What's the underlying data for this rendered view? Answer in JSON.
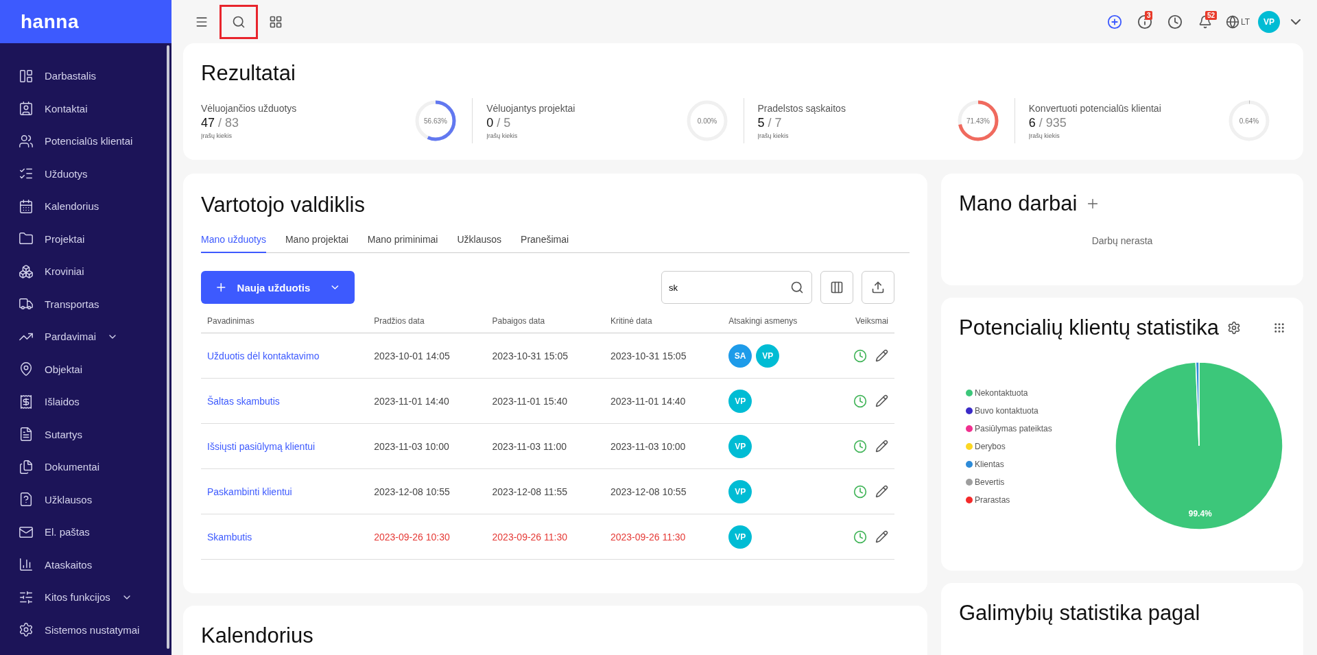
{
  "sidebar": {
    "logo": "hanna",
    "items": [
      {
        "label": "Darbastalis",
        "expandable": false
      },
      {
        "label": "Kontaktai",
        "expandable": false
      },
      {
        "label": "Potencialūs klientai",
        "expandable": false
      },
      {
        "label": "Užduotys",
        "expandable": false
      },
      {
        "label": "Kalendorius",
        "expandable": false
      },
      {
        "label": "Projektai",
        "expandable": false
      },
      {
        "label": "Kroviniai",
        "expandable": false
      },
      {
        "label": "Transportas",
        "expandable": false
      },
      {
        "label": "Pardavimai",
        "expandable": true
      },
      {
        "label": "Objektai",
        "expandable": false
      },
      {
        "label": "Išlaidos",
        "expandable": false
      },
      {
        "label": "Sutartys",
        "expandable": false
      },
      {
        "label": "Dokumentai",
        "expandable": false
      },
      {
        "label": "Užklausos",
        "expandable": false
      },
      {
        "label": "El. paštas",
        "expandable": false
      },
      {
        "label": "Ataskaitos",
        "expandable": false
      },
      {
        "label": "Kitos funkcijos",
        "expandable": true
      },
      {
        "label": "Sistemos nustatymai",
        "expandable": false
      }
    ]
  },
  "topbar": {
    "search_highlighted": true,
    "info_badge": "3",
    "notifications_badge": "52",
    "language": "LT",
    "user_initials": "VP"
  },
  "results": {
    "title": "Rezultatai",
    "metrics": [
      {
        "label": "Vėluojančios užduotys",
        "value": "47",
        "total": "/ 83",
        "caption": "Įrašų kiekis",
        "percent": "56.63%",
        "level": 0.5663,
        "color": "#6278f0"
      },
      {
        "label": "Vėluojantys projektai",
        "value": "0",
        "total": "/ 5",
        "caption": "Įrašų kiekis",
        "percent": "0.00%",
        "level": 0
      },
      {
        "label": "Pradelstos sąskaitos",
        "value": "5",
        "total": "/ 7",
        "caption": "Įrašų kiekis",
        "percent": "71.43%",
        "level": 0.7143,
        "color": "#f06a5e"
      },
      {
        "label": "Konvertuoti potencialūs klientai",
        "value": "6",
        "total": "/ 935",
        "caption": "Įrašų kiekis",
        "percent": "0.64%",
        "level": 0.0064
      }
    ]
  },
  "user_widget": {
    "title": "Vartotojo valdiklis",
    "tabs": [
      {
        "label": "Mano užduotys",
        "selected": true
      },
      {
        "label": "Mano projektai",
        "selected": false
      },
      {
        "label": "Mano priminimai",
        "selected": false
      },
      {
        "label": "Užklausos",
        "selected": false
      },
      {
        "label": "Pranešimai",
        "selected": false
      }
    ],
    "new_button": "Nauja užduotis",
    "search": {
      "value": "sk"
    },
    "columns": [
      "Pavadinimas",
      "Pradžios data",
      "Pabaigos data",
      "Kritinė data",
      "Atsakingi asmenys",
      "Veiksmai"
    ],
    "rows": [
      {
        "name": "Užduotis dėl kontaktavimo",
        "start": "2023-10-01 14:05",
        "end": "2023-10-31 15:05",
        "critical": "2023-10-31 15:05",
        "overdue": false,
        "assignees": [
          {
            "initials": "SA",
            "color": "#1e9be9"
          },
          {
            "initials": "VP",
            "color": "#00bcd4"
          }
        ]
      },
      {
        "name": "Šaltas skambutis",
        "start": "2023-11-01 14:40",
        "end": "2023-11-01 15:40",
        "critical": "2023-11-01 14:40",
        "overdue": false,
        "assignees": [
          {
            "initials": "VP",
            "color": "#00bcd4"
          }
        ]
      },
      {
        "name": "Išsiųsti pasiūlymą klientui",
        "start": "2023-11-03 10:00",
        "end": "2023-11-03 11:00",
        "critical": "2023-11-03 10:00",
        "overdue": false,
        "assignees": [
          {
            "initials": "VP",
            "color": "#00bcd4"
          }
        ]
      },
      {
        "name": "Paskambinti klientui",
        "start": "2023-12-08 10:55",
        "end": "2023-12-08 11:55",
        "critical": "2023-12-08 10:55",
        "overdue": false,
        "assignees": [
          {
            "initials": "VP",
            "color": "#00bcd4"
          }
        ]
      },
      {
        "name": "Skambutis",
        "start": "2023-09-26 10:30",
        "end": "2023-09-26 11:30",
        "critical": "2023-09-26 11:30",
        "overdue": true,
        "assignees": [
          {
            "initials": "VP",
            "color": "#00bcd4"
          }
        ]
      }
    ]
  },
  "calendar": {
    "title": "Kalendorius"
  },
  "my_jobs": {
    "title": "Mano darbai",
    "empty": "Darbų nerasta"
  },
  "lead_stats": {
    "title": "Potencialių klientų statistika",
    "chart_data": {
      "type": "pie",
      "categories": [
        "Nekontaktuota",
        "Buvo kontaktuota",
        "Pasiūlymas pateiktas",
        "Derybos",
        "Klientas",
        "Bevertis",
        "Prarastas"
      ],
      "series": [
        {
          "values": [
            99.4,
            0,
            0,
            0,
            0.6,
            0,
            0
          ]
        }
      ],
      "colors": [
        "#3cc77a",
        "#3b2bc7",
        "#f0308f",
        "#fcd723",
        "#2d8bd8",
        "#9e9e9e",
        "#f42a2a"
      ],
      "value_labels": [
        "99.4%",
        null,
        null,
        null,
        null,
        null,
        null
      ]
    }
  },
  "opportunity_stats": {
    "title": "Galimybių statistika pagal"
  }
}
